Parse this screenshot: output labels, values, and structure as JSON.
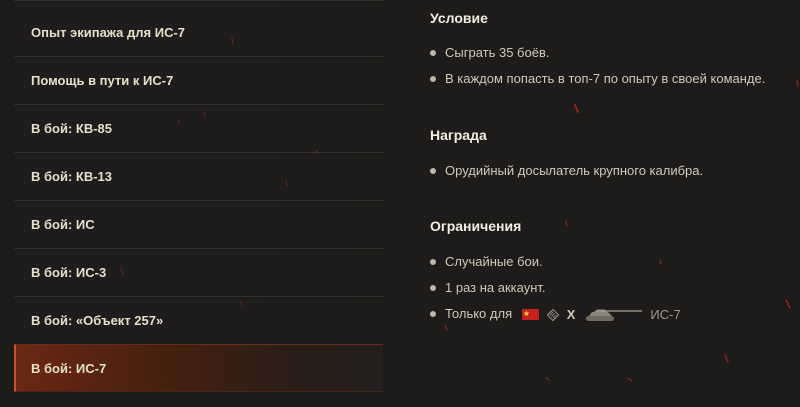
{
  "missions": [
    {
      "label": "Опыт экипажа для ИС-7",
      "active": false
    },
    {
      "label": "Помощь в пути к ИС-7",
      "active": false
    },
    {
      "label": "В бой: КВ-85",
      "active": false
    },
    {
      "label": "В бой: КВ-13",
      "active": false
    },
    {
      "label": "В бой: ИС",
      "active": false
    },
    {
      "label": "В бой: ИС-3",
      "active": false
    },
    {
      "label": "В бой: «Объект 257»",
      "active": false
    },
    {
      "label": "В бой: ИС-7",
      "active": true
    }
  ],
  "details": {
    "condition": {
      "title": "Условие",
      "items": [
        "Сыграть 35 боёв.",
        "В каждом попасть в топ-7 по опыту в своей команде."
      ]
    },
    "reward": {
      "title": "Награда",
      "items": [
        "Орудийный досылатель крупного калибра."
      ]
    },
    "restrictions": {
      "title": "Ограничения",
      "items": [
        "Случайные бои.",
        "1 раз на аккаунт."
      ],
      "only_for": {
        "label": "Только для",
        "nation_icon": "flag-ussr-icon",
        "type_icon": "heavy-tank-icon",
        "tier": "X",
        "tank_icon": "tank-silhouette-icon",
        "tank_name": "ИС-7"
      }
    }
  },
  "colors": {
    "background": "#1d1c1b",
    "accent": "#c8502a",
    "text_primary": "#e6e0c8",
    "text_secondary": "#cfc9b6",
    "flag_red": "#c5201e"
  }
}
